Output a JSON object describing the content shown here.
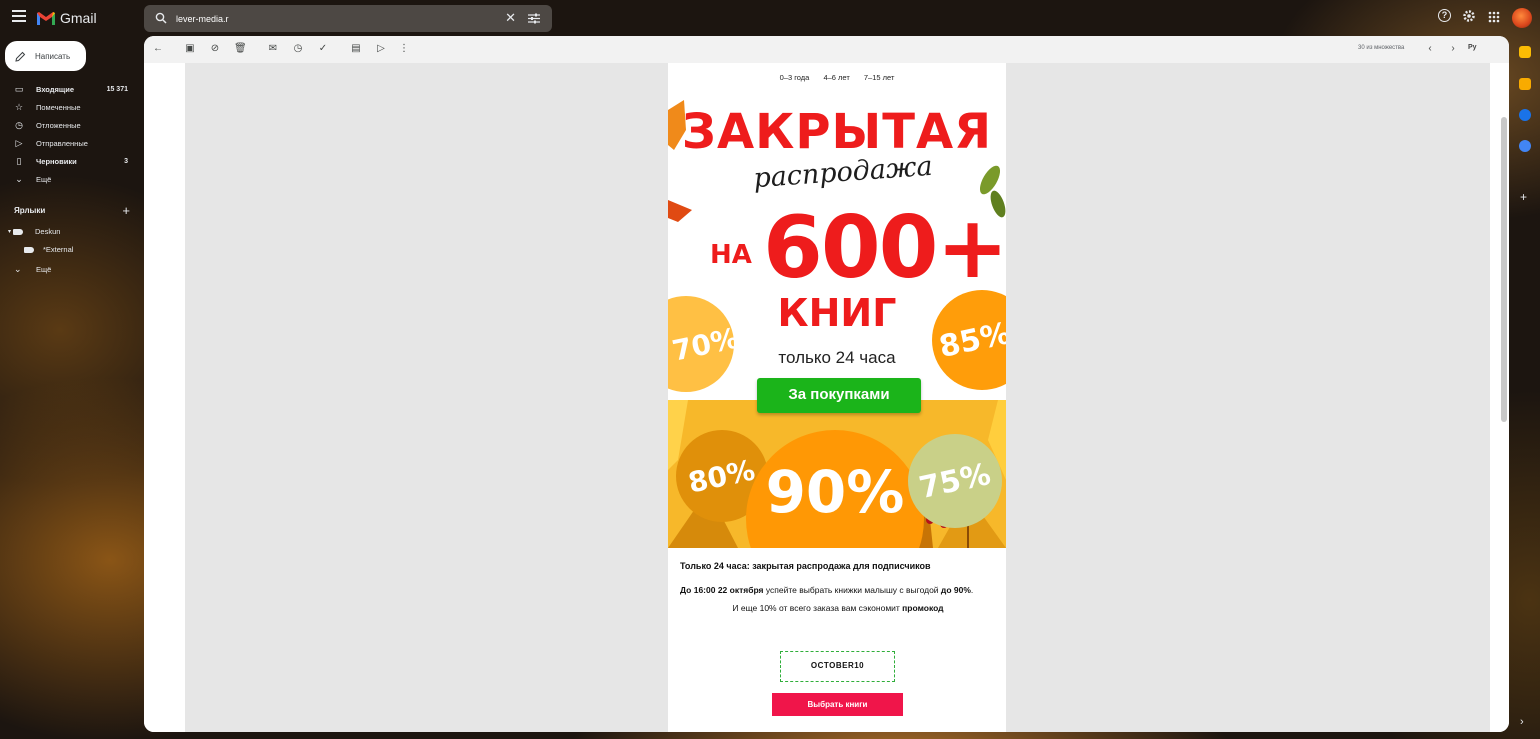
{
  "app": {
    "name": "Gmail"
  },
  "search": {
    "value": "lever-media.r"
  },
  "compose": {
    "label": "Написать"
  },
  "nav": {
    "items": [
      {
        "label": "Входящие",
        "count": "15 371",
        "icon": "inbox-icon"
      },
      {
        "label": "Помеченные",
        "count": "",
        "icon": "star-icon"
      },
      {
        "label": "Отложенные",
        "count": "",
        "icon": "clock-icon"
      },
      {
        "label": "Отправленные",
        "count": "",
        "icon": "send-icon"
      },
      {
        "label": "Черновики",
        "count": "3",
        "icon": "draft-icon"
      },
      {
        "label": "Ещё",
        "count": "",
        "icon": "chevron-down-icon"
      }
    ]
  },
  "labels": {
    "heading": "Ярлыки",
    "items": [
      {
        "label": "Deskun"
      },
      {
        "label": "*External"
      },
      {
        "label": "Ещё"
      }
    ]
  },
  "toolbar": {
    "pagination": "30 из множества",
    "lang": "Ру"
  },
  "email": {
    "age_nav": [
      "0–3 года",
      "4–6 лет",
      "7–15 лет"
    ],
    "banner": {
      "title": "ЗАКРЫТАЯ",
      "script": "распродажа",
      "na": "НА",
      "count": "600+",
      "knig": "КНИГ",
      "hours": "только 24 часа",
      "button": "За покупками",
      "discounts": [
        "70%",
        "85%",
        "80%",
        "90%",
        "75%"
      ]
    },
    "headline": "Только 24 часа: закрытая распродажа для подписчиков",
    "para1_bold": "До 16:00 22 октября",
    "para1_text": " успейте выбрать книжки малышу с выгодой ",
    "para1_bold2": "до 90%",
    "para1_end": ".",
    "para2_text": "И еще 10% от всего заказа вам сэкономит ",
    "para2_bold": "промокод",
    "promo_code": "OCTOBER10",
    "choose_button": "Выбрать книги"
  },
  "colors": {
    "brand_red": "#ee1c1c",
    "cta_green": "#1bb41a",
    "cta_pink": "#f0154a"
  }
}
